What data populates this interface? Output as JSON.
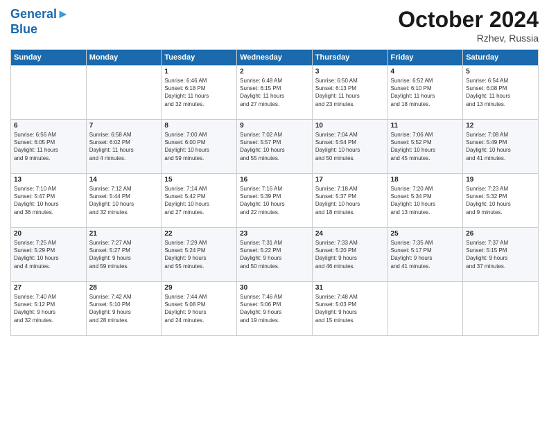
{
  "logo": {
    "line1": "General",
    "line2": "Blue"
  },
  "header": {
    "title": "October 2024",
    "subtitle": "Rzhev, Russia"
  },
  "weekdays": [
    "Sunday",
    "Monday",
    "Tuesday",
    "Wednesday",
    "Thursday",
    "Friday",
    "Saturday"
  ],
  "weeks": [
    [
      {
        "day": "",
        "info": ""
      },
      {
        "day": "",
        "info": ""
      },
      {
        "day": "1",
        "info": "Sunrise: 6:46 AM\nSunset: 6:18 PM\nDaylight: 11 hours\nand 32 minutes."
      },
      {
        "day": "2",
        "info": "Sunrise: 6:48 AM\nSunset: 6:15 PM\nDaylight: 11 hours\nand 27 minutes."
      },
      {
        "day": "3",
        "info": "Sunrise: 6:50 AM\nSunset: 6:13 PM\nDaylight: 11 hours\nand 23 minutes."
      },
      {
        "day": "4",
        "info": "Sunrise: 6:52 AM\nSunset: 6:10 PM\nDaylight: 11 hours\nand 18 minutes."
      },
      {
        "day": "5",
        "info": "Sunrise: 6:54 AM\nSunset: 6:08 PM\nDaylight: 11 hours\nand 13 minutes."
      }
    ],
    [
      {
        "day": "6",
        "info": "Sunrise: 6:56 AM\nSunset: 6:05 PM\nDaylight: 11 hours\nand 9 minutes."
      },
      {
        "day": "7",
        "info": "Sunrise: 6:58 AM\nSunset: 6:02 PM\nDaylight: 11 hours\nand 4 minutes."
      },
      {
        "day": "8",
        "info": "Sunrise: 7:00 AM\nSunset: 6:00 PM\nDaylight: 10 hours\nand 59 minutes."
      },
      {
        "day": "9",
        "info": "Sunrise: 7:02 AM\nSunset: 5:57 PM\nDaylight: 10 hours\nand 55 minutes."
      },
      {
        "day": "10",
        "info": "Sunrise: 7:04 AM\nSunset: 5:54 PM\nDaylight: 10 hours\nand 50 minutes."
      },
      {
        "day": "11",
        "info": "Sunrise: 7:06 AM\nSunset: 5:52 PM\nDaylight: 10 hours\nand 45 minutes."
      },
      {
        "day": "12",
        "info": "Sunrise: 7:08 AM\nSunset: 5:49 PM\nDaylight: 10 hours\nand 41 minutes."
      }
    ],
    [
      {
        "day": "13",
        "info": "Sunrise: 7:10 AM\nSunset: 5:47 PM\nDaylight: 10 hours\nand 36 minutes."
      },
      {
        "day": "14",
        "info": "Sunrise: 7:12 AM\nSunset: 5:44 PM\nDaylight: 10 hours\nand 32 minutes."
      },
      {
        "day": "15",
        "info": "Sunrise: 7:14 AM\nSunset: 5:42 PM\nDaylight: 10 hours\nand 27 minutes."
      },
      {
        "day": "16",
        "info": "Sunrise: 7:16 AM\nSunset: 5:39 PM\nDaylight: 10 hours\nand 22 minutes."
      },
      {
        "day": "17",
        "info": "Sunrise: 7:18 AM\nSunset: 5:37 PM\nDaylight: 10 hours\nand 18 minutes."
      },
      {
        "day": "18",
        "info": "Sunrise: 7:20 AM\nSunset: 5:34 PM\nDaylight: 10 hours\nand 13 minutes."
      },
      {
        "day": "19",
        "info": "Sunrise: 7:23 AM\nSunset: 5:32 PM\nDaylight: 10 hours\nand 9 minutes."
      }
    ],
    [
      {
        "day": "20",
        "info": "Sunrise: 7:25 AM\nSunset: 5:29 PM\nDaylight: 10 hours\nand 4 minutes."
      },
      {
        "day": "21",
        "info": "Sunrise: 7:27 AM\nSunset: 5:27 PM\nDaylight: 9 hours\nand 59 minutes."
      },
      {
        "day": "22",
        "info": "Sunrise: 7:29 AM\nSunset: 5:24 PM\nDaylight: 9 hours\nand 55 minutes."
      },
      {
        "day": "23",
        "info": "Sunrise: 7:31 AM\nSunset: 5:22 PM\nDaylight: 9 hours\nand 50 minutes."
      },
      {
        "day": "24",
        "info": "Sunrise: 7:33 AM\nSunset: 5:20 PM\nDaylight: 9 hours\nand 46 minutes."
      },
      {
        "day": "25",
        "info": "Sunrise: 7:35 AM\nSunset: 5:17 PM\nDaylight: 9 hours\nand 41 minutes."
      },
      {
        "day": "26",
        "info": "Sunrise: 7:37 AM\nSunset: 5:15 PM\nDaylight: 9 hours\nand 37 minutes."
      }
    ],
    [
      {
        "day": "27",
        "info": "Sunrise: 7:40 AM\nSunset: 5:12 PM\nDaylight: 9 hours\nand 32 minutes."
      },
      {
        "day": "28",
        "info": "Sunrise: 7:42 AM\nSunset: 5:10 PM\nDaylight: 9 hours\nand 28 minutes."
      },
      {
        "day": "29",
        "info": "Sunrise: 7:44 AM\nSunset: 5:08 PM\nDaylight: 9 hours\nand 24 minutes."
      },
      {
        "day": "30",
        "info": "Sunrise: 7:46 AM\nSunset: 5:06 PM\nDaylight: 9 hours\nand 19 minutes."
      },
      {
        "day": "31",
        "info": "Sunrise: 7:48 AM\nSunset: 5:03 PM\nDaylight: 9 hours\nand 15 minutes."
      },
      {
        "day": "",
        "info": ""
      },
      {
        "day": "",
        "info": ""
      }
    ]
  ]
}
